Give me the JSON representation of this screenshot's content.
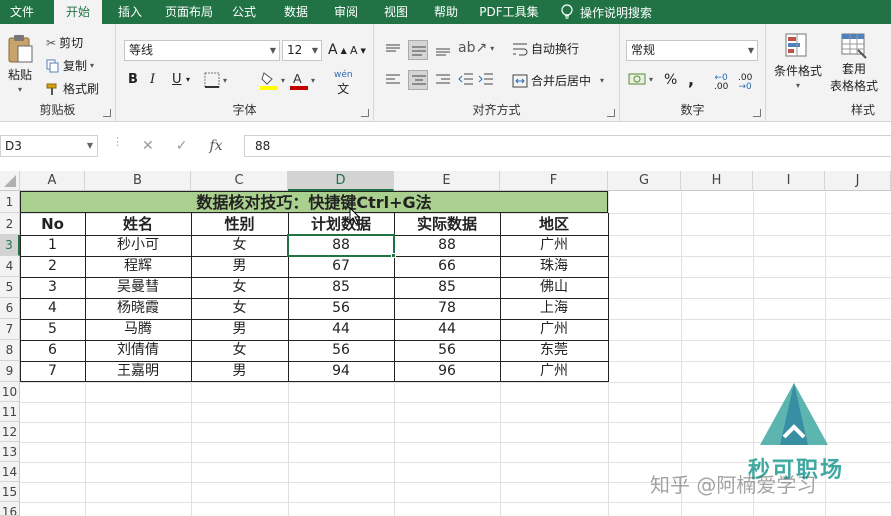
{
  "tabs": [
    "文件",
    "开始",
    "插入",
    "页面布局",
    "公式",
    "数据",
    "审阅",
    "视图",
    "帮助",
    "PDF工具集"
  ],
  "active_tab": "开始",
  "tell_me": "操作说明搜索",
  "clipboard": {
    "paste": "粘贴",
    "cut": "剪切",
    "copy": "复制",
    "format_painter": "格式刷",
    "label": "剪贴板"
  },
  "font": {
    "name": "等线",
    "size": "12",
    "bold": "B",
    "italic": "I",
    "underline": "U",
    "grow": "A",
    "shrink": "A",
    "phonetic": "wén",
    "label": "字体"
  },
  "alignment": {
    "wrap": "自动换行",
    "merge": "合并后居中",
    "label": "对齐方式"
  },
  "number": {
    "format": "常规",
    "percent": "%",
    "comma": ",",
    "label": "数字"
  },
  "styles": {
    "conditional": "条件格式",
    "table_format_1": "套用",
    "table_format_2": "表格格式",
    "label": "样式"
  },
  "formula_bar": {
    "name_box": "D3",
    "cancel": "✕",
    "enter": "✓",
    "fx": "fx",
    "value": "88"
  },
  "columns": [
    "A",
    "B",
    "C",
    "D",
    "E",
    "F",
    "G",
    "H",
    "I",
    "J"
  ],
  "rows": [
    "1",
    "2",
    "3",
    "4",
    "5",
    "6",
    "7",
    "8",
    "9",
    "10",
    "11",
    "12",
    "13",
    "14",
    "15",
    "16"
  ],
  "sheet": {
    "title": "数据核对技巧：快捷键Ctrl+G法",
    "headers": [
      "No",
      "姓名",
      "性别",
      "计划数据",
      "实际数据",
      "地区"
    ],
    "data": [
      [
        "1",
        "秒小可",
        "女",
        "88",
        "88",
        "广州"
      ],
      [
        "2",
        "程辉",
        "男",
        "67",
        "66",
        "珠海"
      ],
      [
        "3",
        "吴曼彗",
        "女",
        "85",
        "85",
        "佛山"
      ],
      [
        "4",
        "杨晓霞",
        "女",
        "56",
        "78",
        "上海"
      ],
      [
        "5",
        "马腾",
        "男",
        "44",
        "44",
        "广州"
      ],
      [
        "6",
        "刘倩倩",
        "女",
        "56",
        "56",
        "东莞"
      ],
      [
        "7",
        "王嘉明",
        "男",
        "94",
        "96",
        "广州"
      ]
    ]
  },
  "watermark": {
    "brand": "秒可职场",
    "text": "知乎 @阿楠爱学习"
  },
  "colors": {
    "accent": "#217346",
    "title_fill": "#a9d08e"
  }
}
